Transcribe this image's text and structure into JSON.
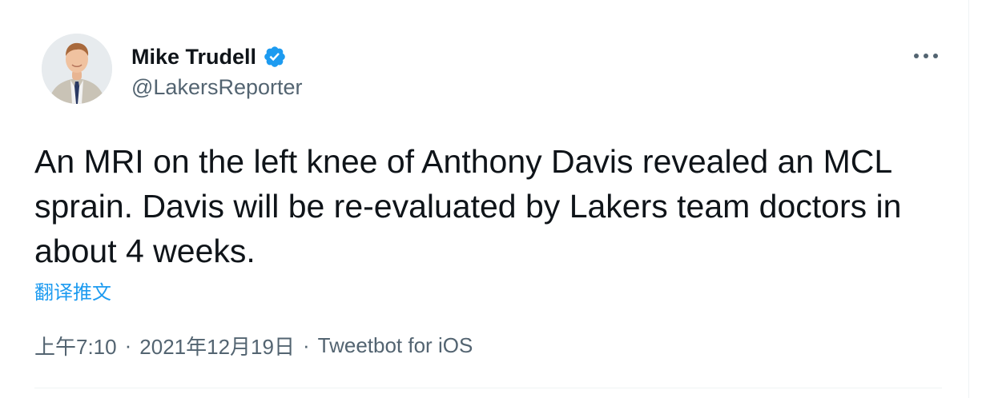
{
  "author": {
    "name": "Mike Trudell",
    "handle": "@LakersReporter",
    "verified": true,
    "avatar_icon": "profile-photo"
  },
  "tweet": {
    "text": "An MRI on the left knee of Anthony Davis revealed an MCL sprain. Davis will be re-evaluated by Lakers team doctors in about 4 weeks.",
    "translate_label": "翻译推文",
    "time": "上午7:10",
    "date": "2021年12月19日",
    "separator": "·",
    "source": "Tweetbot for iOS"
  },
  "icons": {
    "verified": "verified-badge-icon",
    "more": "more-horizontal-icon"
  },
  "colors": {
    "accent": "#1d9bf0",
    "text": "#0f1419",
    "secondary": "#536471"
  }
}
